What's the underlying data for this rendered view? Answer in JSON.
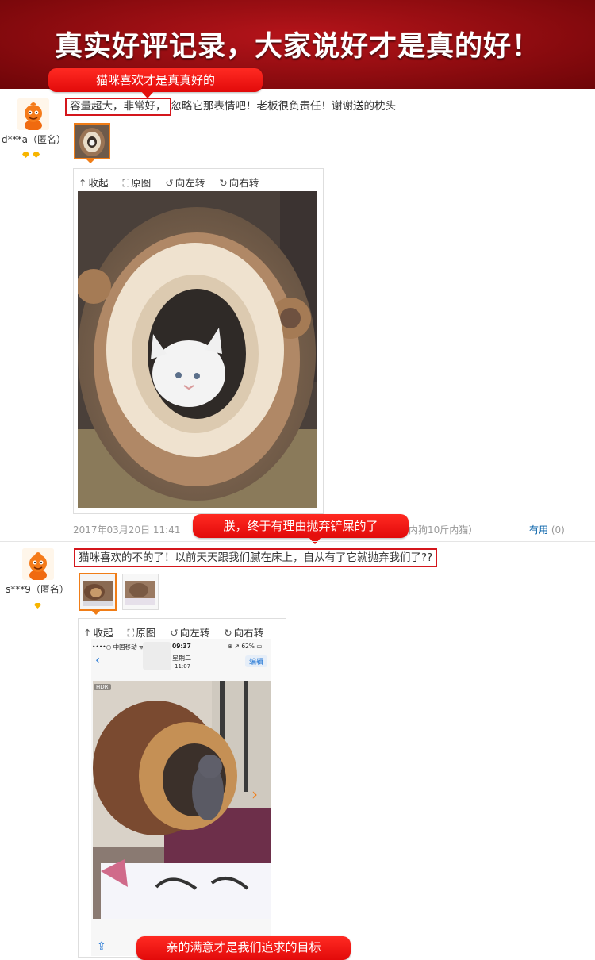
{
  "banner": {
    "title": "真实好评记录，大家说好才是真的好！"
  },
  "callouts": {
    "first": "猫咪喜欢才是真真好的",
    "second": "朕，终于有理由抛弃铲屎的了",
    "third": "亲的满意才是我们追求的目标"
  },
  "viewer_toolbar": {
    "collapse": "收起",
    "original": "原图",
    "rotate_left": "向左转",
    "rotate_right": "向右转"
  },
  "reviews": [
    {
      "user": "d***a（匿名）",
      "text_highlighted": "容量超大，非常好，",
      "text_rest": "忽略它那表情吧！老板很负责任！谢谢送的枕头",
      "date": "2017年03月20日 11:41",
      "spec_fragment": "内狗10斤内猫）",
      "useful_label": "有用",
      "useful_count": "(0)"
    },
    {
      "user": "s***9（匿名）",
      "text_highlighted": "猫咪喜欢的不的了！以前天天跟我们腻在床上，自从有了它就抛弃我们了??",
      "phone": {
        "carrier": "••••○ 中国移动 ᯤ",
        "time": "09:37",
        "battery": "⊕ ↗ 62% ▭",
        "date_line1": "星期二",
        "date_line2": "11:07",
        "edit": "编辑",
        "hdr": "HDR"
      }
    }
  ],
  "colors": {
    "accent_red": "#e20a0a",
    "selected_orange": "#f07d17",
    "link_blue": "#005ea7"
  }
}
